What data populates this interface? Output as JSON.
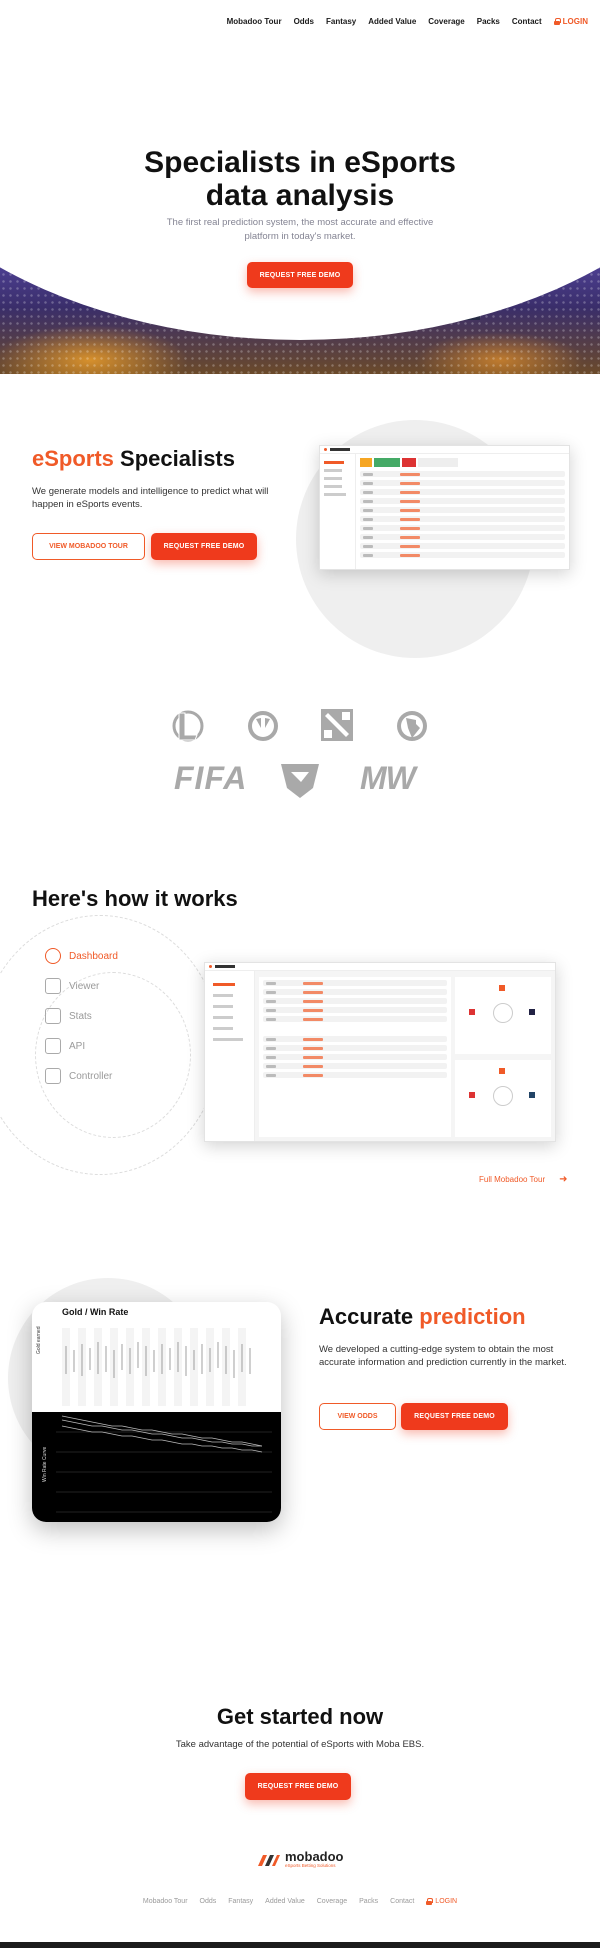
{
  "nav": {
    "items": [
      "Mobadoo Tour",
      "Odds",
      "Fantasy",
      "Added Value",
      "Coverage",
      "Packs",
      "Contact"
    ],
    "login": "LOGIN"
  },
  "hero": {
    "title_line1": "Specialists in eSports",
    "title_line2": "data analysis",
    "subtitle": "The first real prediction system, the most accurate and effective",
    "subtitle_line2": "platform in today's market.",
    "cta": "REQUEST FREE DEMO"
  },
  "specialists": {
    "title_accent": "eSports",
    "title_rest": " Specialists",
    "text": "We generate models and intelligence to predict what will happen in eSports events.",
    "tour_button": "VIEW MOBADOO TOUR",
    "demo_button": "REQUEST FREE DEMO"
  },
  "games": {
    "logos": [
      "league-of-legends",
      "overwatch",
      "dota-2",
      "counter-strike",
      "fifa",
      "rocket-league",
      "call-of-duty-mw"
    ],
    "fifa_text": "FIFA",
    "mw_text": "MW"
  },
  "how": {
    "title": "Here's how it works",
    "items": [
      "Dashboard",
      "Viewer",
      "Stats",
      "API",
      "Controller"
    ],
    "active": "Dashboard",
    "tour_link": "Full Mobadoo Tour"
  },
  "prediction": {
    "card_title": "Gold / Win Rate",
    "ylabel_top": "Gold earned",
    "ylabel_bottom": "Win Rate Curve",
    "title_plain": "Accurate ",
    "title_accent": "prediction",
    "text": "We developed a cutting-edge system to obtain the most accurate information and prediction currently in the market.",
    "odds_button": "VIEW ODDS",
    "demo_button": "REQUEST FREE DEMO"
  },
  "started": {
    "title": "Get started now",
    "text": "Take advantage of the potential of eSports with Moba EBS.",
    "cta": "REQUEST FREE DEMO"
  },
  "footer": {
    "brand": "mobadoo",
    "tagline": "eSports Betting Solutions",
    "links": [
      "Mobadoo Tour",
      "Odds",
      "Fantasy",
      "Added Value",
      "Coverage",
      "Packs",
      "Contact"
    ],
    "login": "LOGIN"
  },
  "colors": {
    "accent": "#f05a28",
    "button": "#ef3a1c"
  }
}
